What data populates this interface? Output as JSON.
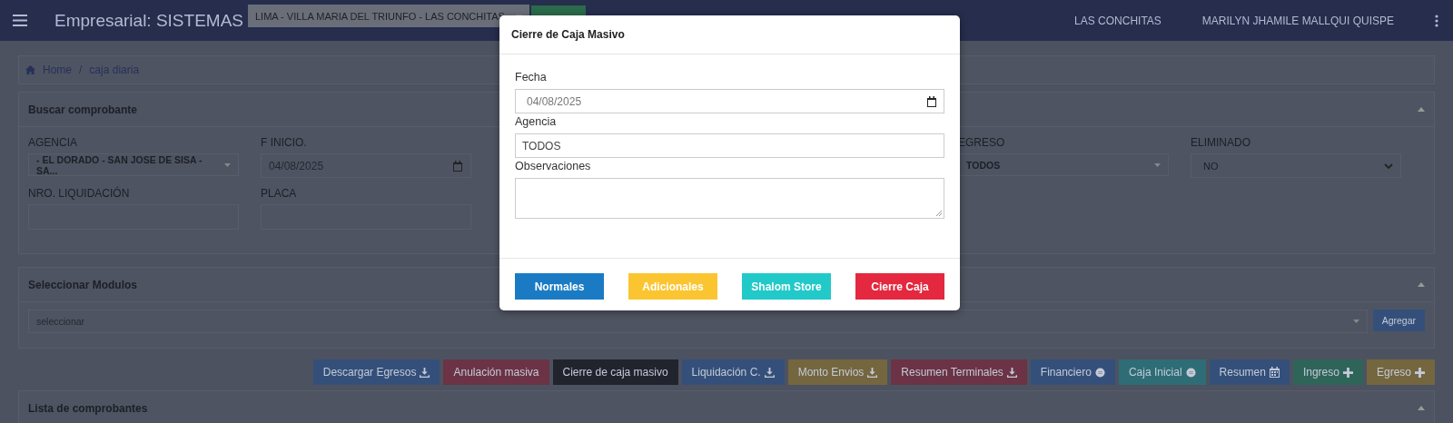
{
  "header": {
    "title": "Empresarial: SISTEMAS",
    "location_select": "LIMA - VILLA MARIA DEL TRIUNFO - LAS CONCHITAS",
    "user_location": "LAS CONCHITAS",
    "user_name": "MARILYN JHAMILE MALLQUI QUISPE"
  },
  "breadcrumb": {
    "items": [
      "Home",
      "caja diaria"
    ],
    "separator": "/"
  },
  "search_panel": {
    "title": "Buscar comprobante",
    "fields": [
      {
        "label": "AGENCIA",
        "kind": "select",
        "value": "- EL DORADO - SAN JOSE DE SISA - SA..."
      },
      {
        "label": "F INICIO.",
        "kind": "date",
        "value": "04/08/2025"
      },
      {
        "kind": "hidden"
      },
      {
        "kind": "hidden"
      },
      {
        "label": "EGRESO",
        "kind": "select",
        "value": "TODOS"
      },
      {
        "label": "ELIMINADO",
        "kind": "native-select",
        "value": "NO"
      },
      {
        "label": "NRO. LIQUIDACIÓN",
        "kind": "text"
      },
      {
        "label": "PLACA",
        "kind": "text"
      }
    ]
  },
  "modules_panel": {
    "title": "Seleccionar Modulos",
    "select_placeholder": "seleccionar",
    "add_button": "Agregar"
  },
  "action_buttons": [
    {
      "label": "Descargar Egresos",
      "color": "#34507a",
      "kind": "download"
    },
    {
      "label": "Anulación masiva",
      "color": "#6b3345",
      "kind": "plain"
    },
    {
      "label": "Cierre de caja masivo",
      "color": "#21242d",
      "kind": "plain"
    },
    {
      "label": "Liquidación C.",
      "color": "#34507a",
      "kind": "download"
    },
    {
      "label": "Monto Envios",
      "color": "#74663e",
      "kind": "download"
    },
    {
      "label": "Resumen Terminales",
      "color": "#6b3345",
      "kind": "download"
    },
    {
      "label": "Financiero",
      "color": "#34507a",
      "kind": "status"
    },
    {
      "label": "Caja Inicial",
      "color": "#2e6d75",
      "kind": "status"
    },
    {
      "label": "Resumen",
      "color": "#34507a",
      "kind": "schedule"
    },
    {
      "label": "Ingreso",
      "color": "#2f6559",
      "kind": "add"
    },
    {
      "label": "Egreso",
      "color": "#74663e",
      "kind": "add"
    }
  ],
  "list_panel": {
    "title": "Lista de comprobantes"
  },
  "modal": {
    "title": "Cierre de Caja Masivo",
    "fields": [
      {
        "label": "Fecha",
        "kind": "date",
        "value": "04/08/2025"
      },
      {
        "label": "Agencia",
        "kind": "text",
        "value": "TODOS"
      },
      {
        "label": "Observaciones",
        "kind": "textarea"
      }
    ],
    "buttons": [
      {
        "label": "Normales",
        "color": "#1a7bc4"
      },
      {
        "label": "Adicionales",
        "color": "#fbc531"
      },
      {
        "label": "Shalom Store",
        "color": "#22c9c9"
      },
      {
        "label": "Cierre Caja",
        "color": "#e3283f"
      }
    ]
  }
}
